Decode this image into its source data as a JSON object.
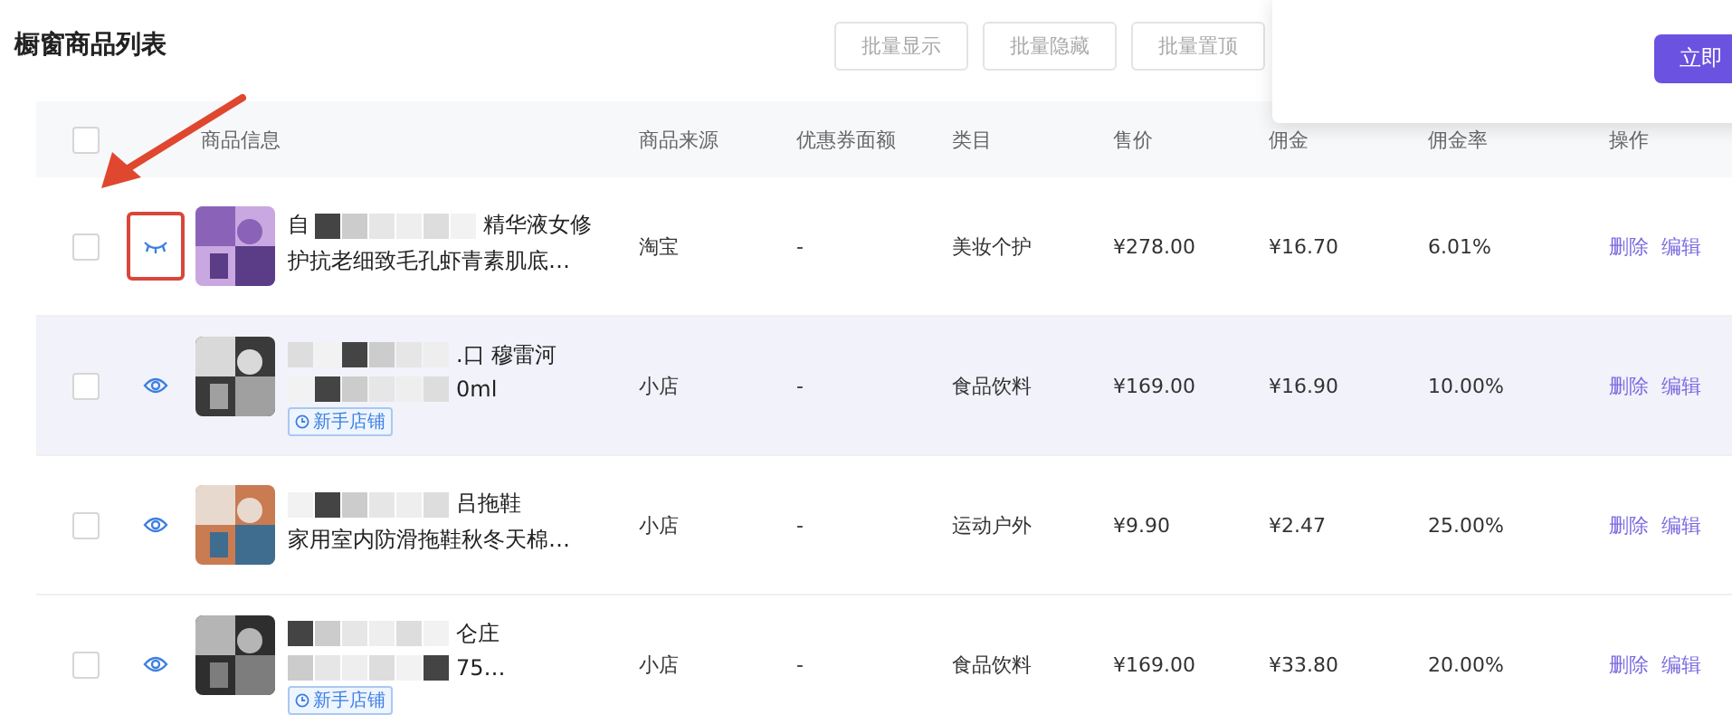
{
  "title": "橱窗商品列表",
  "bulk_buttons": [
    {
      "label": "批量显示"
    },
    {
      "label": "批量隐藏"
    },
    {
      "label": "批量置顶"
    }
  ],
  "popup": {
    "button": "立即"
  },
  "table": {
    "select_all_checked": false,
    "columns": [
      "商品信息",
      "商品来源",
      "优惠券面额",
      "类目",
      "售价",
      "佣金",
      "佣金率",
      "操作"
    ],
    "rows": [
      {
        "checked": false,
        "visible": false,
        "highlighted": false,
        "annotated": true,
        "title_lines": [
          {
            "redacted_before": false,
            "parts": [
              "自",
              "精华液女修"
            ]
          },
          {
            "redacted_before": false,
            "parts": [
              "护抗老细致毛孔虾青素肌底…"
            ]
          }
        ],
        "tag": null,
        "source": "淘宝",
        "coupon": "-",
        "category": "美妆个护",
        "price": "¥278.00",
        "commission": "¥16.70",
        "rate": "6.01%",
        "actions": [
          "删除",
          "编辑"
        ]
      },
      {
        "checked": false,
        "visible": true,
        "highlighted": true,
        "annotated": false,
        "title_lines": [
          {
            "redacted_before": true,
            "parts": [
              ".口 穆雷河"
            ]
          },
          {
            "redacted_before": true,
            "parts": [
              "0ml"
            ]
          }
        ],
        "tag": "新手店铺",
        "source": "小店",
        "coupon": "-",
        "category": "食品饮料",
        "price": "¥169.00",
        "commission": "¥16.90",
        "rate": "10.00%",
        "actions": [
          "删除",
          "编辑"
        ]
      },
      {
        "checked": false,
        "visible": true,
        "highlighted": false,
        "annotated": false,
        "title_lines": [
          {
            "redacted_before": true,
            "parts": [
              "吕拖鞋"
            ]
          },
          {
            "redacted_before": false,
            "parts": [
              "家用室内防滑拖鞋秋冬天棉…"
            ]
          }
        ],
        "tag": null,
        "source": "小店",
        "coupon": "-",
        "category": "运动户外",
        "price": "¥9.90",
        "commission": "¥2.47",
        "rate": "25.00%",
        "actions": [
          "删除",
          "编辑"
        ]
      },
      {
        "checked": false,
        "visible": true,
        "highlighted": false,
        "annotated": false,
        "title_lines": [
          {
            "redacted_before": true,
            "parts": [
              "仑庄"
            ]
          },
          {
            "redacted_before": true,
            "parts": [
              "75…"
            ]
          }
        ],
        "tag": "新手店铺",
        "source": "小店",
        "coupon": "-",
        "category": "食品饮料",
        "price": "¥169.00",
        "commission": "¥33.80",
        "rate": "20.00%",
        "actions": [
          "删除",
          "编辑"
        ]
      }
    ]
  }
}
